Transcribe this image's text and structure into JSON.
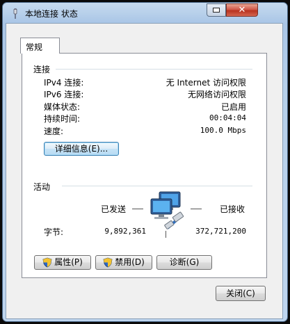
{
  "window": {
    "title": "本地连接 状态",
    "close_glyph": "✕"
  },
  "tabs": [
    {
      "label": "常规"
    }
  ],
  "connection": {
    "section_title": "连接",
    "rows": [
      {
        "label": "IPv4 连接:",
        "value": "无 Internet 访问权限"
      },
      {
        "label": "IPv6 连接:",
        "value": "无网络访问权限"
      },
      {
        "label": "媒体状态:",
        "value": "已启用"
      },
      {
        "label": "持续时间:",
        "value": "00:04:04"
      },
      {
        "label": "速度:",
        "value": "100.0 Mbps"
      }
    ],
    "details_button": "详细信息(E)..."
  },
  "activity": {
    "section_title": "活动",
    "sent_label": "已发送",
    "received_label": "已接收",
    "bytes_label": "字节:",
    "bytes_sent": "9,892,361",
    "bytes_received": "372,721,200"
  },
  "actions": {
    "properties_button": "属性(P)",
    "disable_button": "禁用(D)",
    "diagnose_button": "诊断(G)"
  },
  "footer": {
    "close_button": "关闭(C)"
  },
  "icons": {
    "app": "network-plug-icon",
    "computers": "network-computers-icon",
    "shield": "uac-shield-icon"
  }
}
